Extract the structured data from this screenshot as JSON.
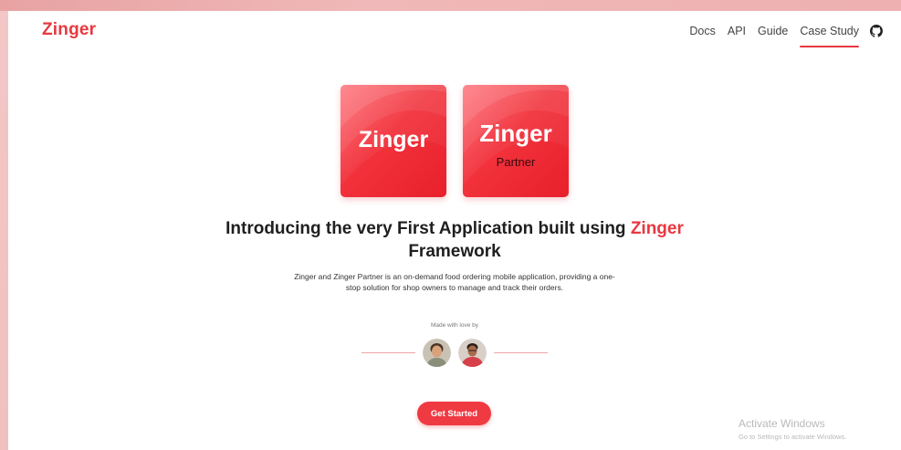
{
  "brand": {
    "name": "Zinger",
    "color": "#e8383f"
  },
  "nav": {
    "items": [
      "Docs",
      "API",
      "Guide",
      "Case Study"
    ],
    "active": "Case Study",
    "github_icon": "github-icon"
  },
  "logos": {
    "tile_a": {
      "title": "Zinger"
    },
    "tile_b": {
      "title": "Zinger",
      "subtitle": "Partner"
    }
  },
  "hero": {
    "headline_prefix": "Introducing the very First Application built using",
    "headline_accent": "Zinger",
    "headline_suffix": "Framework",
    "description_line1": "Zinger and Zinger Partner is an on-demand food ordering mobile application, providing a one-",
    "description_line2": "stop solution for shop owners to manage and track their orders."
  },
  "credits": {
    "label": "Made with love by",
    "avatars": [
      "developer-avatar-1",
      "developer-avatar-2"
    ]
  },
  "cta": {
    "label": "Get Started",
    "color": "#ef3a42"
  },
  "watermark": {
    "line1": "Activate Windows",
    "line2": "Go to Settings to activate Windows."
  }
}
